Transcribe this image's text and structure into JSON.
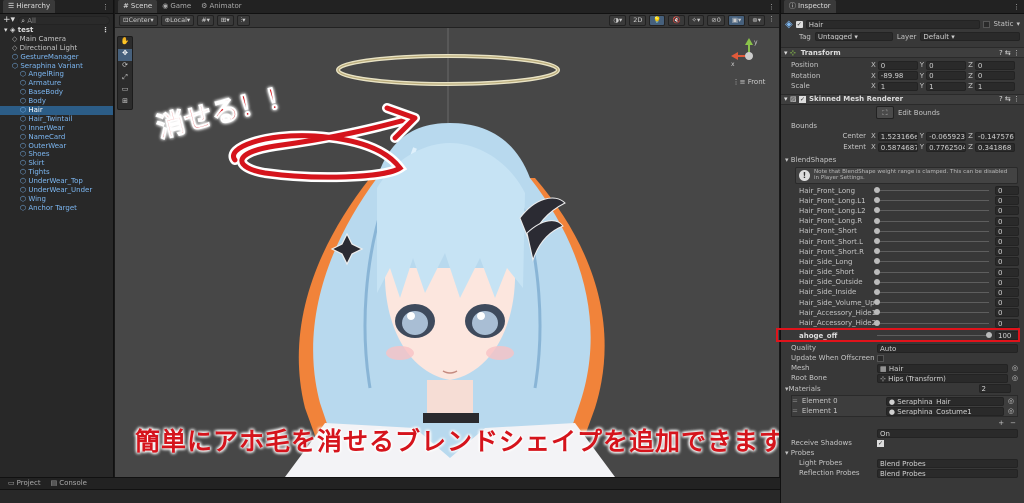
{
  "hierarchy": {
    "tab": "Hierarchy",
    "search_placeholder": "All",
    "scene_name": "test",
    "items": [
      {
        "label": "Main Camera",
        "indent": 1,
        "prefab": false,
        "selected": false
      },
      {
        "label": "Directional Light",
        "indent": 1,
        "prefab": false,
        "selected": false
      },
      {
        "label": "GestureManager",
        "indent": 1,
        "prefab": true,
        "selected": false
      },
      {
        "label": "Seraphina Variant",
        "indent": 1,
        "prefab": true,
        "selected": false
      },
      {
        "label": "AngelRing",
        "indent": 2,
        "prefab": true,
        "selected": false
      },
      {
        "label": "Armature",
        "indent": 2,
        "prefab": true,
        "selected": false
      },
      {
        "label": "BaseBody",
        "indent": 2,
        "prefab": true,
        "selected": false
      },
      {
        "label": "Body",
        "indent": 2,
        "prefab": true,
        "selected": false
      },
      {
        "label": "Hair",
        "indent": 2,
        "prefab": true,
        "selected": true
      },
      {
        "label": "Hair_Twintail",
        "indent": 2,
        "prefab": true,
        "selected": false
      },
      {
        "label": "InnerWear",
        "indent": 2,
        "prefab": true,
        "selected": false
      },
      {
        "label": "NameCard",
        "indent": 2,
        "prefab": true,
        "selected": false
      },
      {
        "label": "OuterWear",
        "indent": 2,
        "prefab": true,
        "selected": false
      },
      {
        "label": "Shoes",
        "indent": 2,
        "prefab": true,
        "selected": false
      },
      {
        "label": "Skirt",
        "indent": 2,
        "prefab": true,
        "selected": false
      },
      {
        "label": "Tights",
        "indent": 2,
        "prefab": true,
        "selected": false
      },
      {
        "label": "UnderWear_Top",
        "indent": 2,
        "prefab": true,
        "selected": false
      },
      {
        "label": "UnderWear_Under",
        "indent": 2,
        "prefab": true,
        "selected": false
      },
      {
        "label": "Wing",
        "indent": 2,
        "prefab": true,
        "selected": false
      },
      {
        "label": "Anchor Target",
        "indent": 2,
        "prefab": true,
        "selected": false
      }
    ]
  },
  "scene": {
    "tabs": [
      "Scene",
      "Game",
      "Animator"
    ],
    "pivot": "Center",
    "space": "Local",
    "mode_2d": "2D",
    "gizmo_label": "Front",
    "annotation_top": "消せる！！",
    "annotation_bottom": "簡単にアホ毛を消せるブレンドシェイプを追加できます！！"
  },
  "bottom": {
    "tabs": [
      "Project",
      "Console"
    ]
  },
  "inspector": {
    "tab": "Inspector",
    "object_name": "Hair",
    "static_label": "Static",
    "tag_label": "Tag",
    "tag_value": "Untagged",
    "layer_label": "Layer",
    "layer_value": "Default",
    "transform": {
      "title": "Transform",
      "rows": [
        {
          "label": "Position",
          "x": "0",
          "y": "0",
          "z": "0"
        },
        {
          "label": "Rotation",
          "x": "-89.98",
          "y": "0",
          "z": "0"
        },
        {
          "label": "Scale",
          "x": "1",
          "y": "1",
          "z": "1"
        }
      ]
    },
    "smr": {
      "title": "Skinned Mesh Renderer",
      "edit_bounds": "Edit Bounds",
      "bounds_label": "Bounds",
      "center_label": "Center",
      "center": {
        "x": "1.523166e-",
        "y": "-0.065923",
        "z": "-0.1475767"
      },
      "extent_label": "Extent",
      "extent": {
        "x": "0.5874687",
        "y": "0.7762504",
        "z": "0.341868"
      },
      "blendshapes_label": "BlendShapes",
      "note": "Note that BlendShape weight range is clamped. This can be disabled in Player Settings.",
      "blendshapes": [
        {
          "name": "Hair_Front_Long",
          "value": "0"
        },
        {
          "name": "Hair_Front_Long.L1",
          "value": "0"
        },
        {
          "name": "Hair_Front_Long.L2",
          "value": "0"
        },
        {
          "name": "Hair_Front_Long.R",
          "value": "0"
        },
        {
          "name": "Hair_Front_Short",
          "value": "0"
        },
        {
          "name": "Hair_Front_Short.L",
          "value": "0"
        },
        {
          "name": "Hair_Front_Short.R",
          "value": "0"
        },
        {
          "name": "Hair_Side_Long",
          "value": "0"
        },
        {
          "name": "Hair_Side_Short",
          "value": "0"
        },
        {
          "name": "Hair_Side_Outside",
          "value": "0"
        },
        {
          "name": "Hair_Side_Inside",
          "value": "0"
        },
        {
          "name": "Hair_Side_Volume_Up",
          "value": "0"
        },
        {
          "name": "Hair_Accessory_Hide1",
          "value": "0"
        },
        {
          "name": "Hair_Accessory_Hide2",
          "value": "0"
        }
      ],
      "ahoge": {
        "name": "ahoge_off",
        "value": "100",
        "fraction": 1.0
      },
      "quality_label": "Quality",
      "quality_value": "Auto",
      "update_offscreen_label": "Update When Offscreen",
      "mesh_label": "Mesh",
      "mesh_value": "Hair",
      "root_bone_label": "Root Bone",
      "root_bone_value": "Hips (Transform)",
      "materials_label": "Materials",
      "materials_count": "2",
      "materials": [
        {
          "label": "Element 0",
          "value": "Seraphina_Hair"
        },
        {
          "label": "Element 1",
          "value": "Seraphina_Costume1"
        }
      ],
      "cast_shadows_value": "On",
      "receive_shadows_label": "Receive Shadows",
      "probes_label": "Probes",
      "light_probes_label": "Light Probes",
      "light_probes_value": "Blend Probes",
      "reflection_probes_label": "Reflection Probes",
      "reflection_probes_value": "Blend Probes"
    },
    "highlight_color": "#e0131b"
  }
}
